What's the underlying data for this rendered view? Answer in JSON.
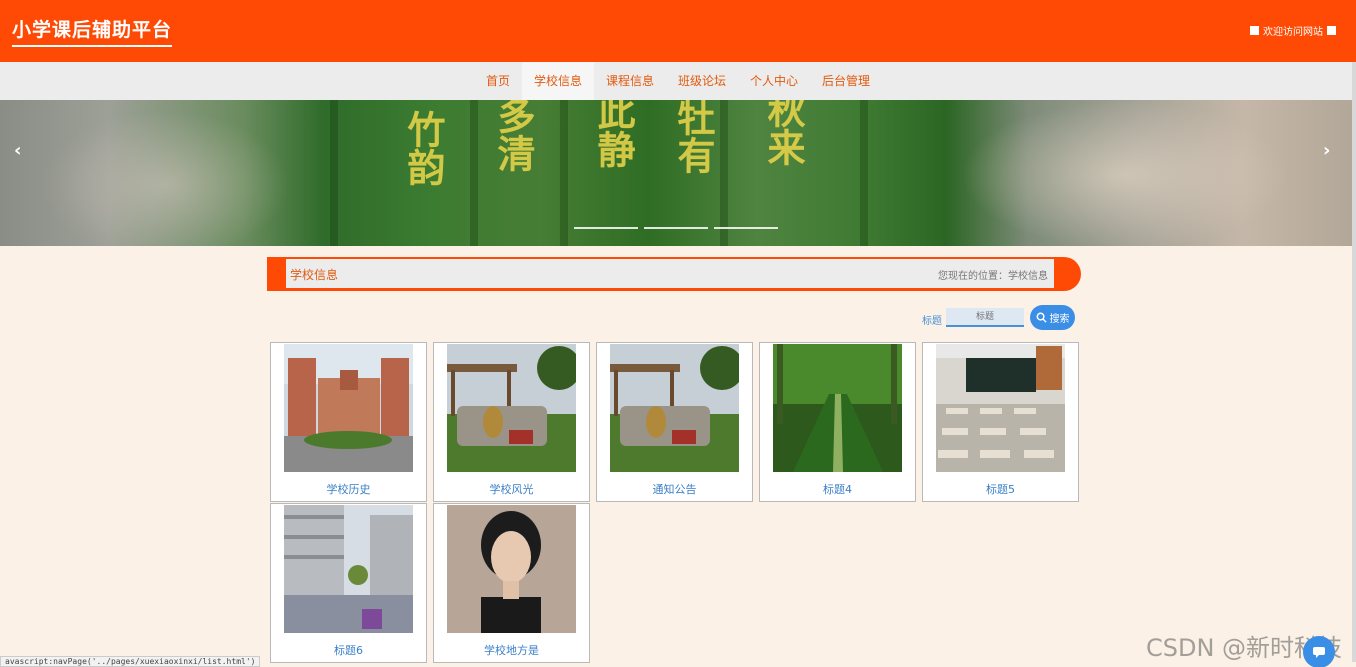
{
  "header": {
    "site_title": "小学课后辅助平台",
    "welcome": "欢迎访问网站"
  },
  "nav": {
    "items": [
      "首页",
      "学校信息",
      "课程信息",
      "班级论坛",
      "个人中心",
      "后台管理"
    ],
    "active": "学校信息"
  },
  "banner": {
    "calligraphy": [
      "竹韵",
      "多清",
      "此静",
      "牡有",
      "秋来"
    ]
  },
  "section": {
    "title": "学校信息",
    "location": "您现在的位置：学校信息"
  },
  "search": {
    "label": "标题",
    "placeholder": "标题",
    "button": "搜索"
  },
  "cards": [
    {
      "title": "学校历史"
    },
    {
      "title": "学校风光"
    },
    {
      "title": "通知公告"
    },
    {
      "title": "标题4"
    },
    {
      "title": "标题5"
    },
    {
      "title": "标题6"
    },
    {
      "title": "学校地方是"
    }
  ],
  "status_url": "avascript:navPage('../pages/xuexiaoxinxi/list.html')",
  "watermark": "CSDN @新时科技",
  "colors": {
    "primary": "#ff4a05",
    "link": "#3a7fc8",
    "accent_blue": "#3a8ee6"
  }
}
